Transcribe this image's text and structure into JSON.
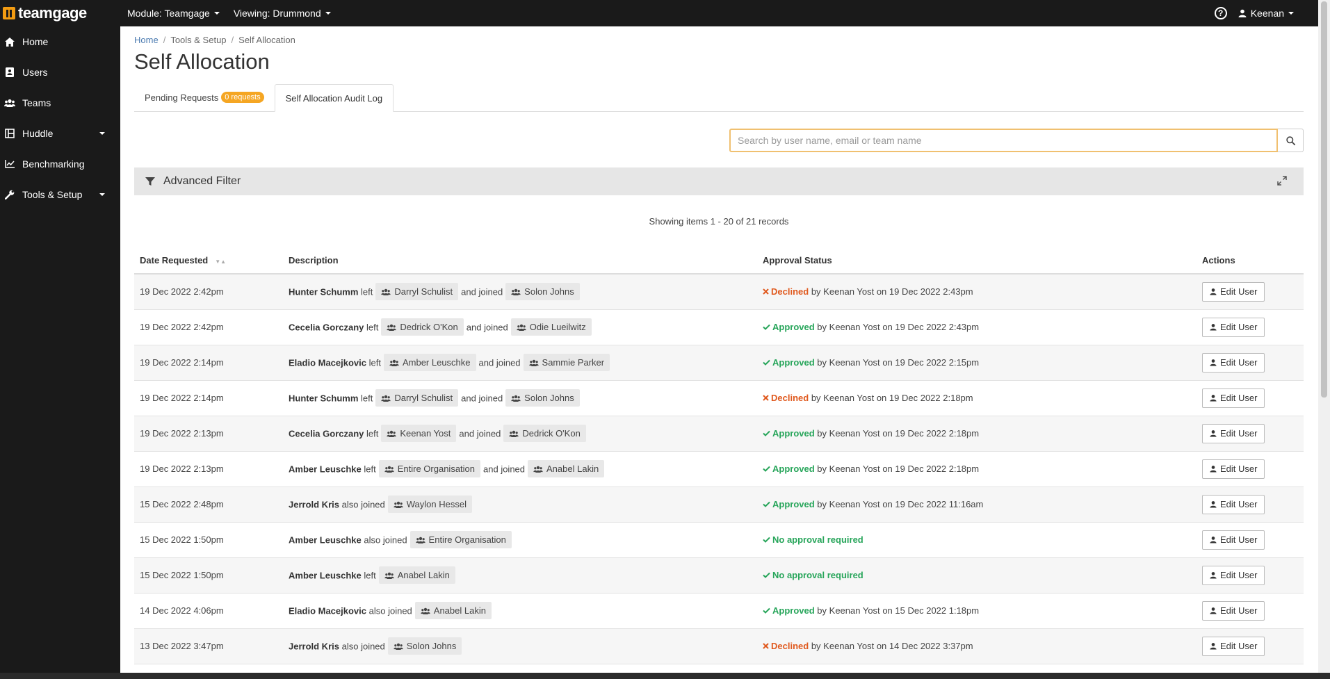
{
  "brand": {
    "name": "teamgage",
    "color": "#f39c12"
  },
  "topbar": {
    "module_label": "Module: Teamgage",
    "viewing_label": "Viewing: Drummond",
    "help_icon": "?",
    "user_name": "Keenan"
  },
  "sidebar": {
    "items": [
      {
        "label": "Home",
        "icon": "home-icon"
      },
      {
        "label": "Users",
        "icon": "address-book-icon"
      },
      {
        "label": "Teams",
        "icon": "users-icon"
      },
      {
        "label": "Huddle",
        "icon": "board-icon"
      },
      {
        "label": "Benchmarking",
        "icon": "line-chart-icon"
      },
      {
        "label": "Tools & Setup",
        "icon": "wrench-icon"
      }
    ]
  },
  "breadcrumb": {
    "home": "Home",
    "tools": "Tools & Setup",
    "current": "Self Allocation",
    "sep": "/"
  },
  "page_title": "Self Allocation",
  "tabs": {
    "pending": "Pending Requests",
    "pending_badge": "0 requests",
    "audit": "Self Allocation Audit Log"
  },
  "search": {
    "placeholder": "Search by user name, email or team name"
  },
  "filter": {
    "label": "Advanced Filter"
  },
  "summary": "Showing items 1 - 20 of 21 records",
  "table": {
    "headers": {
      "date": "Date Requested",
      "description": "Description",
      "status": "Approval Status",
      "actions": "Actions"
    },
    "words": {
      "left": "left",
      "and_joined": "and joined",
      "also_joined": "also joined",
      "by": "by",
      "on": "on",
      "edit": "Edit User"
    },
    "rows": [
      {
        "date": "19 Dec 2022 2:42pm",
        "user": "Hunter Schumm",
        "left_team": "Darryl Schulist",
        "joined_team": "Solon Johns",
        "status": "Declined",
        "by": "Keenan Yost",
        "on": "19 Dec 2022 2:43pm"
      },
      {
        "date": "19 Dec 2022 2:42pm",
        "user": "Cecelia Gorczany",
        "left_team": "Dedrick O'Kon",
        "joined_team": "Odie Lueilwitz",
        "status": "Approved",
        "by": "Keenan Yost",
        "on": "19 Dec 2022 2:43pm"
      },
      {
        "date": "19 Dec 2022 2:14pm",
        "user": "Eladio Macejkovic",
        "left_team": "Amber Leuschke",
        "joined_team": "Sammie Parker",
        "status": "Approved",
        "by": "Keenan Yost",
        "on": "19 Dec 2022 2:15pm"
      },
      {
        "date": "19 Dec 2022 2:14pm",
        "user": "Hunter Schumm",
        "left_team": "Darryl Schulist",
        "joined_team": "Solon Johns",
        "status": "Declined",
        "by": "Keenan Yost",
        "on": "19 Dec 2022 2:18pm"
      },
      {
        "date": "19 Dec 2022 2:13pm",
        "user": "Cecelia Gorczany",
        "left_team": "Keenan Yost",
        "joined_team": "Dedrick O'Kon",
        "status": "Approved",
        "by": "Keenan Yost",
        "on": "19 Dec 2022 2:18pm"
      },
      {
        "date": "19 Dec 2022 2:13pm",
        "user": "Amber Leuschke",
        "left_team": "Entire Organisation",
        "joined_team": "Anabel Lakin",
        "status": "Approved",
        "by": "Keenan Yost",
        "on": "19 Dec 2022 2:18pm"
      },
      {
        "date": "15 Dec 2022 2:48pm",
        "user": "Jerrold Kris",
        "left_team": "",
        "joined_team": "Waylon Hessel",
        "status": "Approved",
        "by": "Keenan Yost",
        "on": "19 Dec 2022 11:16am"
      },
      {
        "date": "15 Dec 2022 1:50pm",
        "user": "Amber Leuschke",
        "left_team": "",
        "joined_team": "Entire Organisation",
        "status": "No approval required",
        "by": "",
        "on": ""
      },
      {
        "date": "15 Dec 2022 1:50pm",
        "user": "Amber Leuschke",
        "left_team": "Anabel Lakin",
        "joined_team": "",
        "status": "No approval required",
        "by": "",
        "on": ""
      },
      {
        "date": "14 Dec 2022 4:06pm",
        "user": "Eladio Macejkovic",
        "left_team": "",
        "joined_team": "Anabel Lakin",
        "status": "Approved",
        "by": "Keenan Yost",
        "on": "15 Dec 2022 1:18pm"
      },
      {
        "date": "13 Dec 2022 3:47pm",
        "user": "Jerrold Kris",
        "left_team": "",
        "joined_team": "Solon Johns",
        "status": "Declined",
        "by": "Keenan Yost",
        "on": "14 Dec 2022 3:37pm"
      }
    ]
  },
  "colors": {
    "declined": "#e05a1f",
    "approved": "#27a55a",
    "badge": "#f5a623"
  }
}
